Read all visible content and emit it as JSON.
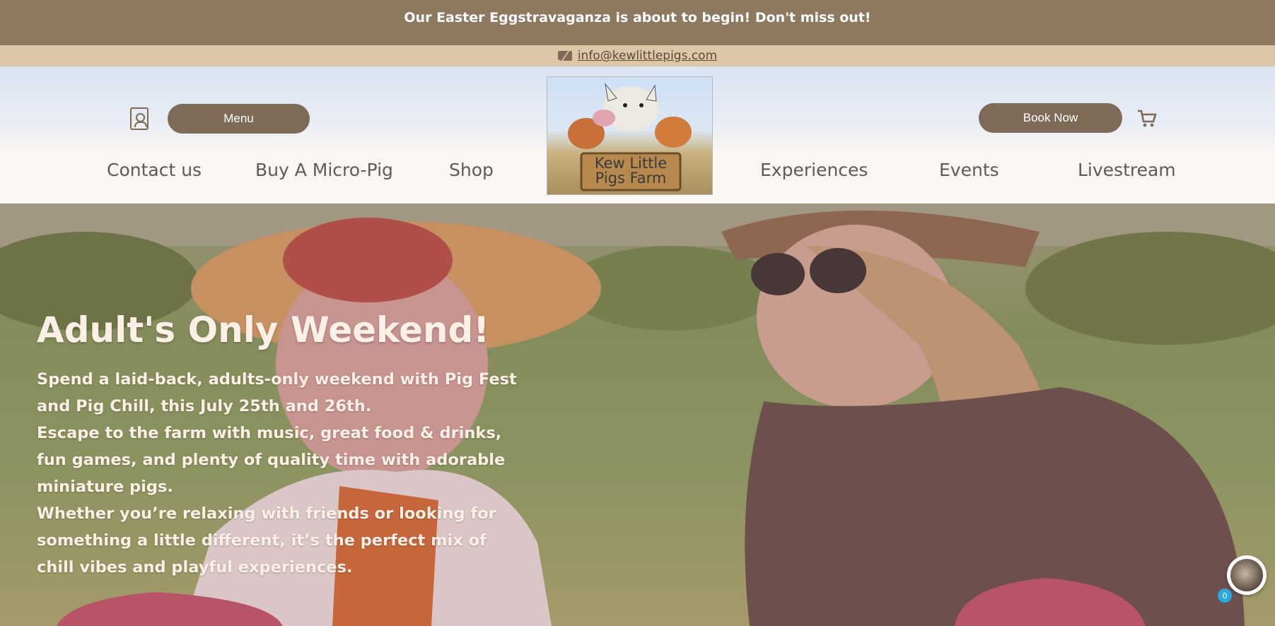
{
  "announcement": "Our Easter Eggstravaganza is about to begin! Don't miss out!",
  "email": "info@kewlittlepigs.com",
  "header": {
    "menu_label": "Menu",
    "book_label": "Book Now",
    "logo_text_line1": "Kew Little",
    "logo_text_line2": "Pigs Farm"
  },
  "nav": {
    "items": [
      "Contact us",
      "Buy A Micro-Pig",
      "Shop",
      "Experiences",
      "Events",
      "Livestream"
    ]
  },
  "hero": {
    "title": "Adult's Only Weekend!",
    "lines": [
      "Spend a laid-back, adults-only weekend with Pig Fest",
      "and Pig Chill, this July 25th and 26th.",
      "Escape to the farm with music, great food & drinks,",
      "fun games, and plenty of quality time with adorable",
      "miniature pigs.",
      "Whether you’re relaxing with friends or looking for",
      "something a little different, it’s the perfect mix of",
      "chill vibes and playful experiences."
    ]
  },
  "chat": {
    "badge": "0"
  },
  "colors": {
    "brand_brown": "#7d6b58",
    "announce_bg": "#8d7860",
    "email_bg": "#dcc8a6"
  }
}
